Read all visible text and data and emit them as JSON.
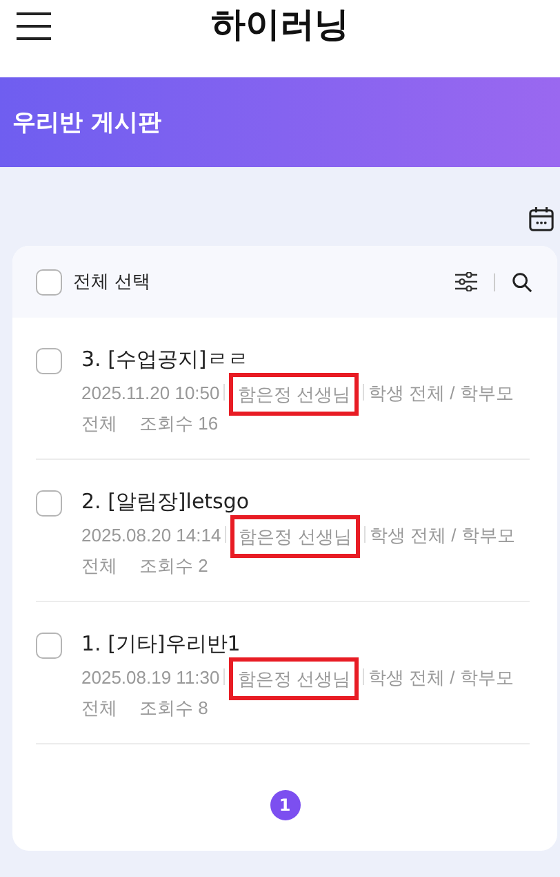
{
  "app_title": "하이러닝",
  "board_title": "우리반 게시판",
  "select_all": {
    "label": "전체 선택",
    "checked": false
  },
  "posts": [
    {
      "title": "3. [수업공지]ㄹㄹ",
      "checked": false,
      "date": "2025.11.20 10:50",
      "author": "함은정 선생님",
      "author_highlighted": true,
      "audience": "학생 전체 / 학부모 전체",
      "views": "조회수 16"
    },
    {
      "title": "2. [알림장]letsgo",
      "checked": false,
      "date": "2025.08.20 14:14",
      "author": "함은정 선생님",
      "author_highlighted": true,
      "audience": "학생 전체 / 학부모 전체",
      "views": "조회수 2"
    },
    {
      "title": "1. [기타]우리반1",
      "checked": false,
      "date": "2025.08.19 11:30",
      "author": "함은정 선생님",
      "author_highlighted": true,
      "audience": "학생 전체 / 학부모 전체",
      "views": "조회수 8"
    }
  ],
  "pages": [
    {
      "label": "1",
      "selected": true
    }
  ]
}
